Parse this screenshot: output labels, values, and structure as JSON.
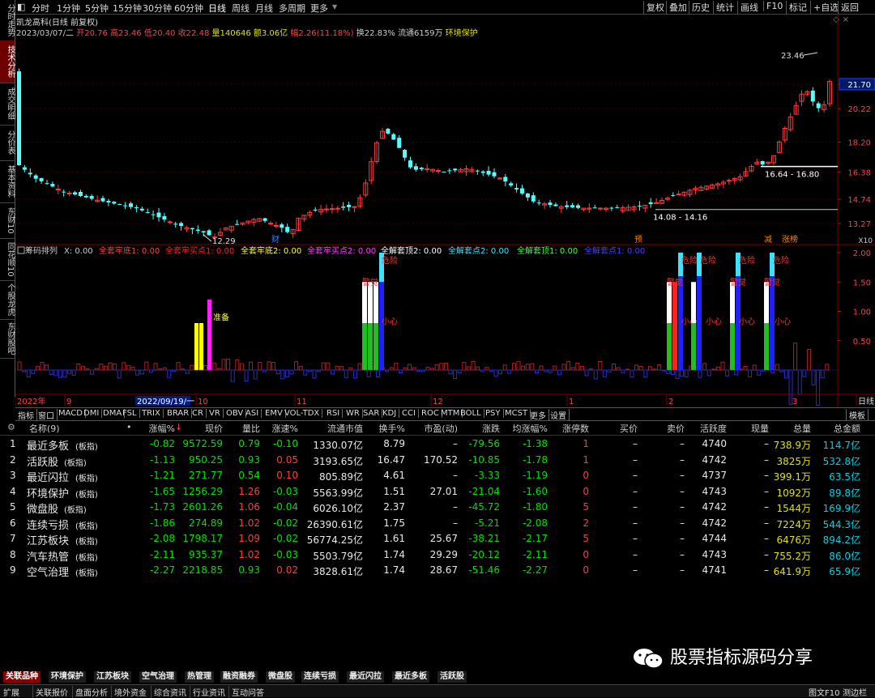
{
  "left_tabs": [
    "分时走势",
    "技术分析",
    "成交明细",
    "分价表",
    "基本资料",
    "东财10",
    "同花顺10",
    "个股龙虎",
    "东财股吧"
  ],
  "toolbar": {
    "periods": [
      "分时",
      "1分钟",
      "5分钟",
      "15分钟",
      "30分钟",
      "60分钟",
      "日线",
      "周线",
      "月线",
      "多周期",
      "更多"
    ],
    "selected_period": "日线",
    "right": [
      "复权",
      "叠加",
      "历史",
      "统计",
      "画线",
      "F10",
      "标记",
      "+自选",
      "返回"
    ]
  },
  "stock": {
    "title": "凯龙高科(日线 前复权)",
    "date": "2023/03/07/二",
    "open": "开20.76",
    "high": "高23.46",
    "low": "低20.40",
    "close": "收22.48",
    "volume": "量140646",
    "amount": "额3.06亿",
    "change": "幅2.26(11.18%)",
    "turnover": "换22.83%",
    "float": "流通6159万",
    "concept": "环境保护"
  },
  "price_axis": [
    "21.70",
    "20.22",
    "18.20",
    "16.38",
    "14.74",
    "13.27"
  ],
  "price_labels": {
    "high_mark": "23.46",
    "low_mark": "12.29",
    "zone1": "16.64 - 16.80",
    "zone2": "14.08 - 14.16",
    "x10": "X10"
  },
  "event_tags": [
    "财",
    "预",
    "减",
    "涨榜"
  ],
  "indicator": {
    "name": "筹码排列",
    "params": [
      {
        "text": "X: 0.00",
        "color": "#ccc"
      },
      {
        "text": "全套牢底1: 0.00",
        "color": "#ff4040"
      },
      {
        "text": "全套牢买点1: 0.00",
        "color": "#ff2020"
      },
      {
        "text": "全套牢底2: 0.00",
        "color": "#ffff40"
      },
      {
        "text": "全套牢买点2: 0.00",
        "color": "#ff40ff"
      },
      {
        "text": "全解套顶2: 0.00",
        "color": "#ffffff"
      },
      {
        "text": "全解套点2: 0.00",
        "color": "#40e0ff"
      },
      {
        "text": "全解套顶1: 0.00",
        "color": "#40ff40"
      },
      {
        "text": "全解套点1: 0.00",
        "color": "#4040ff"
      }
    ],
    "axis": [
      "2.00",
      "1.50",
      "1.00",
      "0.50"
    ],
    "labels": {
      "ready": "准备",
      "danger": "危险",
      "careful": "小心",
      "warning": "警觉"
    }
  },
  "time_axis": [
    "2022年",
    "9",
    "2022/09/19/一",
    "10",
    "11",
    "12",
    "1",
    "2",
    "3",
    "日线"
  ],
  "indicator_tabs": [
    "指标",
    "窗口",
    "MACD",
    "DMI",
    "DMA",
    "FSL",
    "TRIX",
    "BRAR",
    "CR",
    "VR",
    "OBV",
    "ASI",
    "EMV",
    "VOL-TDX",
    "RSI",
    "WR",
    "SAR",
    "KDJ",
    "CCI",
    "ROC",
    "MTM",
    "BOLL",
    "PSY",
    "MCST",
    "更多",
    "设置",
    "模板"
  ],
  "table": {
    "headers": [
      "名称(9)",
      "涨幅%",
      "现价",
      "量比",
      "涨速%",
      "流通市值",
      "换手%",
      "市盈(动)",
      "涨跌",
      "均涨幅%",
      "涨停数",
      "买价",
      "卖价",
      "活跃度",
      "现量",
      "总量",
      "总金额"
    ],
    "rows": [
      {
        "no": "1",
        "name": "最近多板",
        "tag": "(板指)",
        "chg": "-0.82",
        "price": "9572.59",
        "vr": "0.79",
        "spd": "-0.10",
        "cap": "1330.07亿",
        "turn": "8.79",
        "pe": "–",
        "diff": "-79.56",
        "avg": "-1.38",
        "lim": "1",
        "buy": "–",
        "sell": "–",
        "act": "4740",
        "cur": "–",
        "vol": "738.9万",
        "amt": "114.7亿"
      },
      {
        "no": "2",
        "name": "活跃股",
        "tag": "(板指)",
        "chg": "-1.13",
        "price": "950.25",
        "vr": "0.93",
        "spd": "0.05",
        "cap": "3193.65亿",
        "turn": "16.47",
        "pe": "170.52",
        "diff": "-10.85",
        "avg": "-1.78",
        "lim": "1",
        "buy": "–",
        "sell": "–",
        "act": "4742",
        "cur": "–",
        "vol": "3825万",
        "amt": "532.8亿"
      },
      {
        "no": "3",
        "name": "最近闪拉",
        "tag": "(板指)",
        "chg": "-1.21",
        "price": "271.77",
        "vr": "0.54",
        "spd": "0.10",
        "cap": "805.89亿",
        "turn": "4.61",
        "pe": "–",
        "diff": "-3.33",
        "avg": "-1.19",
        "lim": "0",
        "buy": "–",
        "sell": "–",
        "act": "4737",
        "cur": "–",
        "vol": "399.1万",
        "amt": "63.5亿"
      },
      {
        "no": "4",
        "name": "环境保护",
        "tag": "(板指)",
        "chg": "-1.65",
        "price": "1256.29",
        "vr": "1.26",
        "spd": "-0.03",
        "cap": "5563.99亿",
        "turn": "1.51",
        "pe": "27.01",
        "diff": "-21.04",
        "avg": "-1.60",
        "lim": "0",
        "buy": "–",
        "sell": "–",
        "act": "4743",
        "cur": "–",
        "vol": "1092万",
        "amt": "89.8亿"
      },
      {
        "no": "5",
        "name": "微盘股",
        "tag": "(板指)",
        "chg": "-1.73",
        "price": "2601.26",
        "vr": "1.06",
        "spd": "-0.04",
        "cap": "6026.10亿",
        "turn": "2.37",
        "pe": "–",
        "diff": "-45.72",
        "avg": "-1.80",
        "lim": "5",
        "buy": "–",
        "sell": "–",
        "act": "4742",
        "cur": "–",
        "vol": "1544万",
        "amt": "169.9亿"
      },
      {
        "no": "6",
        "name": "连续亏损",
        "tag": "(板指)",
        "chg": "-1.86",
        "price": "274.89",
        "vr": "1.02",
        "spd": "-0.02",
        "cap": "26390.61亿",
        "turn": "1.75",
        "pe": "–",
        "diff": "-5.21",
        "avg": "-2.08",
        "lim": "2",
        "buy": "–",
        "sell": "–",
        "act": "4742",
        "cur": "–",
        "vol": "7224万",
        "amt": "544.3亿"
      },
      {
        "no": "7",
        "name": "江苏板块",
        "tag": "(板指)",
        "chg": "-2.08",
        "price": "1798.17",
        "vr": "1.09",
        "spd": "-0.02",
        "cap": "56774.25亿",
        "turn": "1.61",
        "pe": "25.67",
        "diff": "-38.21",
        "avg": "-2.17",
        "lim": "5",
        "buy": "–",
        "sell": "–",
        "act": "4744",
        "cur": "–",
        "vol": "6476万",
        "amt": "894.2亿"
      },
      {
        "no": "8",
        "name": "汽车热管",
        "tag": "(板指)",
        "chg": "-2.11",
        "price": "935.37",
        "vr": "1.02",
        "spd": "-0.03",
        "cap": "5503.79亿",
        "turn": "1.74",
        "pe": "29.29",
        "diff": "-20.12",
        "avg": "-2.11",
        "lim": "0",
        "buy": "–",
        "sell": "–",
        "act": "4743",
        "cur": "–",
        "vol": "755.2万",
        "amt": "86.0亿"
      },
      {
        "no": "9",
        "name": "空气治理",
        "tag": "(板指)",
        "chg": "-2.27",
        "price": "2218.85",
        "vr": "0.93",
        "spd": "0.02",
        "cap": "3828.61亿",
        "turn": "1.74",
        "pe": "28.67",
        "diff": "-51.46",
        "avg": "-2.27",
        "lim": "0",
        "buy": "–",
        "sell": "–",
        "act": "4741",
        "cur": "–",
        "vol": "641.9万",
        "amt": "65.9亿"
      }
    ]
  },
  "block_tabs": [
    "关联品种",
    "环境保护",
    "江苏板块",
    "空气治理",
    "热管理",
    "融资融券",
    "微盘股",
    "连续亏损",
    "最近闪拉",
    "最近多板",
    "活跃股"
  ],
  "status_bar": [
    "扩展",
    "关联报价",
    "盘面分析",
    "境外资金",
    "综合资讯",
    "行业资讯",
    "互动问答",
    "图文F10",
    "测边栏"
  ],
  "watermark": "股票指标源码分享",
  "colors": {
    "up": "#ff3b3b",
    "down": "#00e000",
    "candle_down": "#54ffff",
    "accent": "#6d0000"
  }
}
